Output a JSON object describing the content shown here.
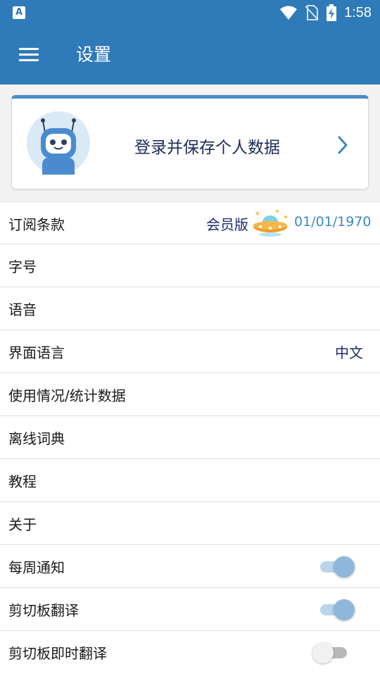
{
  "status_bar": {
    "notification_icon": "A",
    "icons": [
      "wifi-icon",
      "no-sim-icon",
      "battery-charging-icon"
    ],
    "time": "1:58"
  },
  "app_bar": {
    "title": "设置",
    "menu_icon": "hamburger-menu-icon"
  },
  "login_card": {
    "text": "登录并保存个人数据",
    "avatar_icon": "robot-avatar-icon",
    "chevron_icon": "chevron-right-icon",
    "accent_color": "#4a8bd0"
  },
  "settings": {
    "subscription": {
      "label": "订阅条款",
      "tier": "会员版",
      "date": "01/01/1970",
      "icon": "ufo-icon"
    },
    "font_size": {
      "label": "字号"
    },
    "voice": {
      "label": "语音"
    },
    "ui_language": {
      "label": "界面语言",
      "value": "中文"
    },
    "usage_stats": {
      "label": "使用情况/统计数据"
    },
    "offline_dict": {
      "label": "离线词典"
    },
    "tutorial": {
      "label": "教程"
    },
    "about": {
      "label": "关于"
    },
    "weekly_notify": {
      "label": "每周通知",
      "enabled": true
    },
    "clipboard_translate": {
      "label": "剪切板翻译",
      "enabled": true
    },
    "clipboard_instant": {
      "label": "剪切板即时翻译",
      "enabled": false
    }
  },
  "colors": {
    "primary": "#2f7ab8",
    "toggle_on": "#8fb7dc",
    "date_text": "#3b88c9"
  }
}
